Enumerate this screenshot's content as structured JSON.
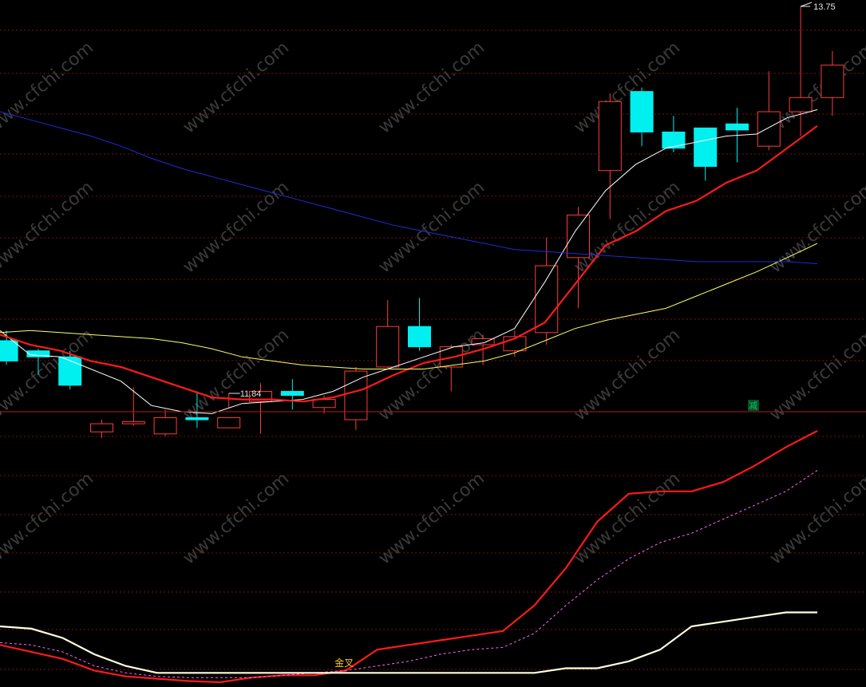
{
  "chart_data": [
    {
      "type": "candlestick",
      "price_range": [
        11.0,
        13.85
      ],
      "candles": [
        {
          "o": 12.1,
          "c": 12.0,
          "h": 12.15,
          "l": 11.98,
          "dir": "down"
        },
        {
          "o": 12.05,
          "c": 12.02,
          "h": 12.06,
          "l": 11.93,
          "dir": "down"
        },
        {
          "o": 12.02,
          "c": 11.88,
          "h": 12.05,
          "l": 11.86,
          "dir": "down"
        },
        {
          "o": 11.65,
          "c": 11.69,
          "h": 11.71,
          "l": 11.62,
          "dir": "up"
        },
        {
          "o": 11.69,
          "c": 11.7,
          "h": 11.87,
          "l": 11.68,
          "dir": "up"
        },
        {
          "o": 11.64,
          "c": 11.72,
          "h": 11.76,
          "l": 11.63,
          "dir": "up"
        },
        {
          "o": 11.72,
          "c": 11.71,
          "h": 11.85,
          "l": 11.67,
          "dir": "down"
        },
        {
          "o": 11.67,
          "c": 11.72,
          "h": 11.77,
          "l": 11.84,
          "dir": "up"
        },
        {
          "o": 11.8,
          "c": 11.85,
          "h": 11.89,
          "l": 11.64,
          "dir": "up"
        },
        {
          "o": 11.85,
          "c": 11.83,
          "h": 11.91,
          "l": 11.76,
          "dir": "down"
        },
        {
          "o": 11.77,
          "c": 11.81,
          "h": 11.83,
          "l": 11.74,
          "dir": "up"
        },
        {
          "o": 11.71,
          "c": 11.95,
          "h": 11.97,
          "l": 11.66,
          "dir": "up"
        },
        {
          "o": 11.97,
          "c": 12.17,
          "h": 12.3,
          "l": 11.96,
          "dir": "up"
        },
        {
          "o": 12.17,
          "c": 12.07,
          "h": 12.31,
          "l": 12.05,
          "dir": "down"
        },
        {
          "o": 11.97,
          "c": 12.07,
          "h": 12.08,
          "l": 11.85,
          "dir": "up"
        },
        {
          "o": 12.08,
          "c": 12.11,
          "h": 12.13,
          "l": 11.98,
          "dir": "up"
        },
        {
          "o": 12.05,
          "c": 12.12,
          "h": 12.15,
          "l": 12.02,
          "dir": "up"
        },
        {
          "o": 12.14,
          "c": 12.47,
          "h": 12.61,
          "l": 12.08,
          "dir": "up"
        },
        {
          "o": 12.51,
          "c": 12.72,
          "h": 12.76,
          "l": 12.26,
          "dir": "up"
        },
        {
          "o": 12.94,
          "c": 13.28,
          "h": 13.32,
          "l": 12.7,
          "dir": "up"
        },
        {
          "o": 13.33,
          "c": 13.13,
          "h": 13.35,
          "l": 13.06,
          "dir": "down"
        },
        {
          "o": 13.13,
          "c": 13.05,
          "h": 13.21,
          "l": 13.03,
          "dir": "down"
        },
        {
          "o": 13.15,
          "c": 12.96,
          "h": 13.15,
          "l": 12.89,
          "dir": "down"
        },
        {
          "o": 13.17,
          "c": 13.14,
          "h": 13.25,
          "l": 12.98,
          "dir": "down"
        },
        {
          "o": 13.06,
          "c": 13.23,
          "h": 13.43,
          "l": 13.04,
          "dir": "up"
        },
        {
          "o": 13.23,
          "c": 13.3,
          "h": 13.75,
          "l": 13.11,
          "dir": "up"
        },
        {
          "o": 13.3,
          "c": 13.46,
          "h": 13.53,
          "l": 13.21,
          "dir": "up"
        }
      ],
      "ma_lines": [
        {
          "color": "#ffffff",
          "values": [
            12.15,
            12.03,
            12.02,
            11.96,
            11.9,
            11.78,
            11.75,
            11.74,
            11.79,
            11.8,
            11.81,
            11.85,
            11.92,
            11.97,
            12.02,
            12.07,
            12.09,
            12.16,
            12.39,
            12.64,
            12.84,
            12.97,
            13.05,
            13.08,
            13.11,
            13.12,
            13.2,
            13.24
          ]
        },
        {
          "color": "#ff1a1a",
          "values": [
            12.13,
            12.08,
            12.05,
            12.0,
            11.97,
            11.92,
            11.87,
            11.82,
            11.81,
            11.81,
            11.8,
            11.82,
            11.86,
            11.93,
            11.99,
            12.02,
            12.06,
            12.11,
            12.19,
            12.38,
            12.57,
            12.64,
            12.74,
            12.79,
            12.88,
            12.94,
            13.05,
            13.16
          ]
        },
        {
          "color": "#ffff66",
          "values": [
            12.14,
            12.15,
            12.14,
            12.13,
            12.12,
            12.11,
            12.09,
            12.06,
            12.02,
            12.0,
            11.98,
            11.97,
            11.96,
            11.96,
            11.96,
            11.98,
            12.0,
            12.04,
            12.1,
            12.16,
            12.2,
            12.23,
            12.26,
            12.32,
            12.38,
            12.44,
            12.51,
            12.58
          ]
        },
        {
          "color": "#1f2bd8",
          "values": [
            13.23,
            13.19,
            13.15,
            13.11,
            13.06,
            13.0,
            12.95,
            12.91,
            12.87,
            12.83,
            12.79,
            12.75,
            12.71,
            12.67,
            12.64,
            12.61,
            12.58,
            12.55,
            12.54,
            12.53,
            12.52,
            12.51,
            12.5,
            12.49,
            12.49,
            12.49,
            12.49,
            12.48
          ]
        }
      ],
      "annotations": [
        {
          "label": "13.75",
          "candle": 25,
          "at": "high"
        },
        {
          "label": "11.84",
          "candle": 7,
          "at": "low"
        }
      ]
    },
    {
      "type": "line",
      "y_range": [
        0,
        100
      ],
      "series": [
        {
          "color": "#ff1a1a",
          "style": "solid",
          "values": [
            16,
            13,
            10,
            5,
            2.5,
            1.5,
            0.5,
            0,
            2,
            3,
            3,
            5,
            14,
            16,
            18,
            20,
            22,
            33,
            49,
            69,
            81,
            82,
            82,
            86,
            93,
            101,
            108
          ]
        },
        {
          "color": "#ff66ff",
          "style": "dashed",
          "values": [
            17,
            16,
            13,
            7,
            4,
            2.5,
            2,
            2,
            2,
            3,
            4,
            5,
            7,
            9,
            12,
            14,
            15,
            21,
            33,
            44,
            53,
            60,
            64,
            70,
            76,
            82,
            91
          ]
        },
        {
          "color": "#ffffdd",
          "style": "solid",
          "values": [
            24,
            23,
            19,
            12,
            7,
            4,
            4,
            4,
            4,
            4,
            4,
            4,
            4,
            4,
            4,
            4,
            4,
            4,
            6,
            6,
            9,
            14,
            24,
            26,
            28,
            30,
            30
          ]
        }
      ],
      "annotations": [
        {
          "label": "金叉",
          "color": "#ffcc00",
          "point": 11
        },
        {
          "label": "减",
          "color": "#00cc66",
          "point": 23
        }
      ]
    }
  ],
  "watermark": "www.cfchi.com"
}
